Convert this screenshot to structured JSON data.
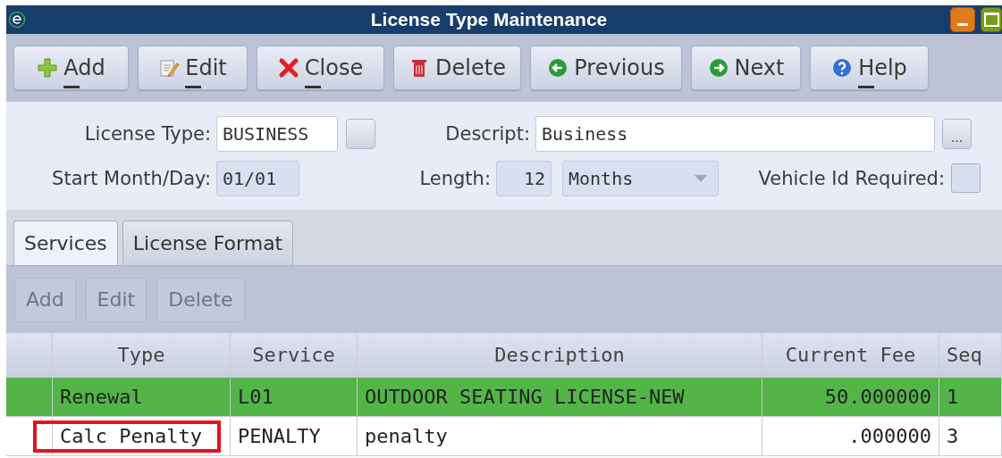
{
  "window": {
    "title": "License Type Maintenance",
    "controls": [
      {
        "kind": "minimize"
      },
      {
        "kind": "maximize"
      }
    ]
  },
  "toolbar": [
    {
      "label": "Add",
      "kind": "add",
      "mnemonic": true
    },
    {
      "label": "Edit",
      "kind": "edit",
      "mnemonic": true
    },
    {
      "label": "Close",
      "kind": "close",
      "mnemonic": true
    },
    {
      "label": "Delete",
      "kind": "delete",
      "mnemonic": false
    },
    {
      "label": "Previous",
      "kind": "previous",
      "mnemonic": false
    },
    {
      "label": "Next",
      "kind": "next",
      "mnemonic": false
    },
    {
      "label": "Help",
      "kind": "help",
      "mnemonic": true
    }
  ],
  "form": {
    "license_type": {
      "label": "License Type:",
      "value": "BUSINESS"
    },
    "description": {
      "label": "Descript:",
      "value": "Business",
      "button": "..."
    },
    "start": {
      "label": "Start Month/Day:",
      "value": "01/01"
    },
    "length": {
      "label": "Length:",
      "value": "12",
      "unit": "Months"
    },
    "vehicle_id": {
      "label": "Vehicle Id Required:",
      "checked": false
    }
  },
  "tabs": [
    {
      "label": "Services",
      "selected": true
    },
    {
      "label": "License Format",
      "selected": false
    }
  ],
  "sub_toolbar": [
    {
      "label": "Add",
      "disabled": true
    },
    {
      "label": "Edit",
      "disabled": true
    },
    {
      "label": "Delete",
      "disabled": true
    }
  ],
  "table": {
    "columns": [
      "Type",
      "Service",
      "Description",
      "Current Fee",
      "Seq"
    ],
    "rows": [
      {
        "cells": [
          "Renewal",
          "L01",
          "OUTDOOR SEATING LICENSE-NEW",
          "50.000000",
          "1"
        ],
        "selected": true,
        "annotated": false
      },
      {
        "cells": [
          "Calc Penalty",
          "PENALTY",
          "penalty",
          ".000000",
          "3"
        ],
        "selected": false,
        "annotated": true
      }
    ]
  }
}
